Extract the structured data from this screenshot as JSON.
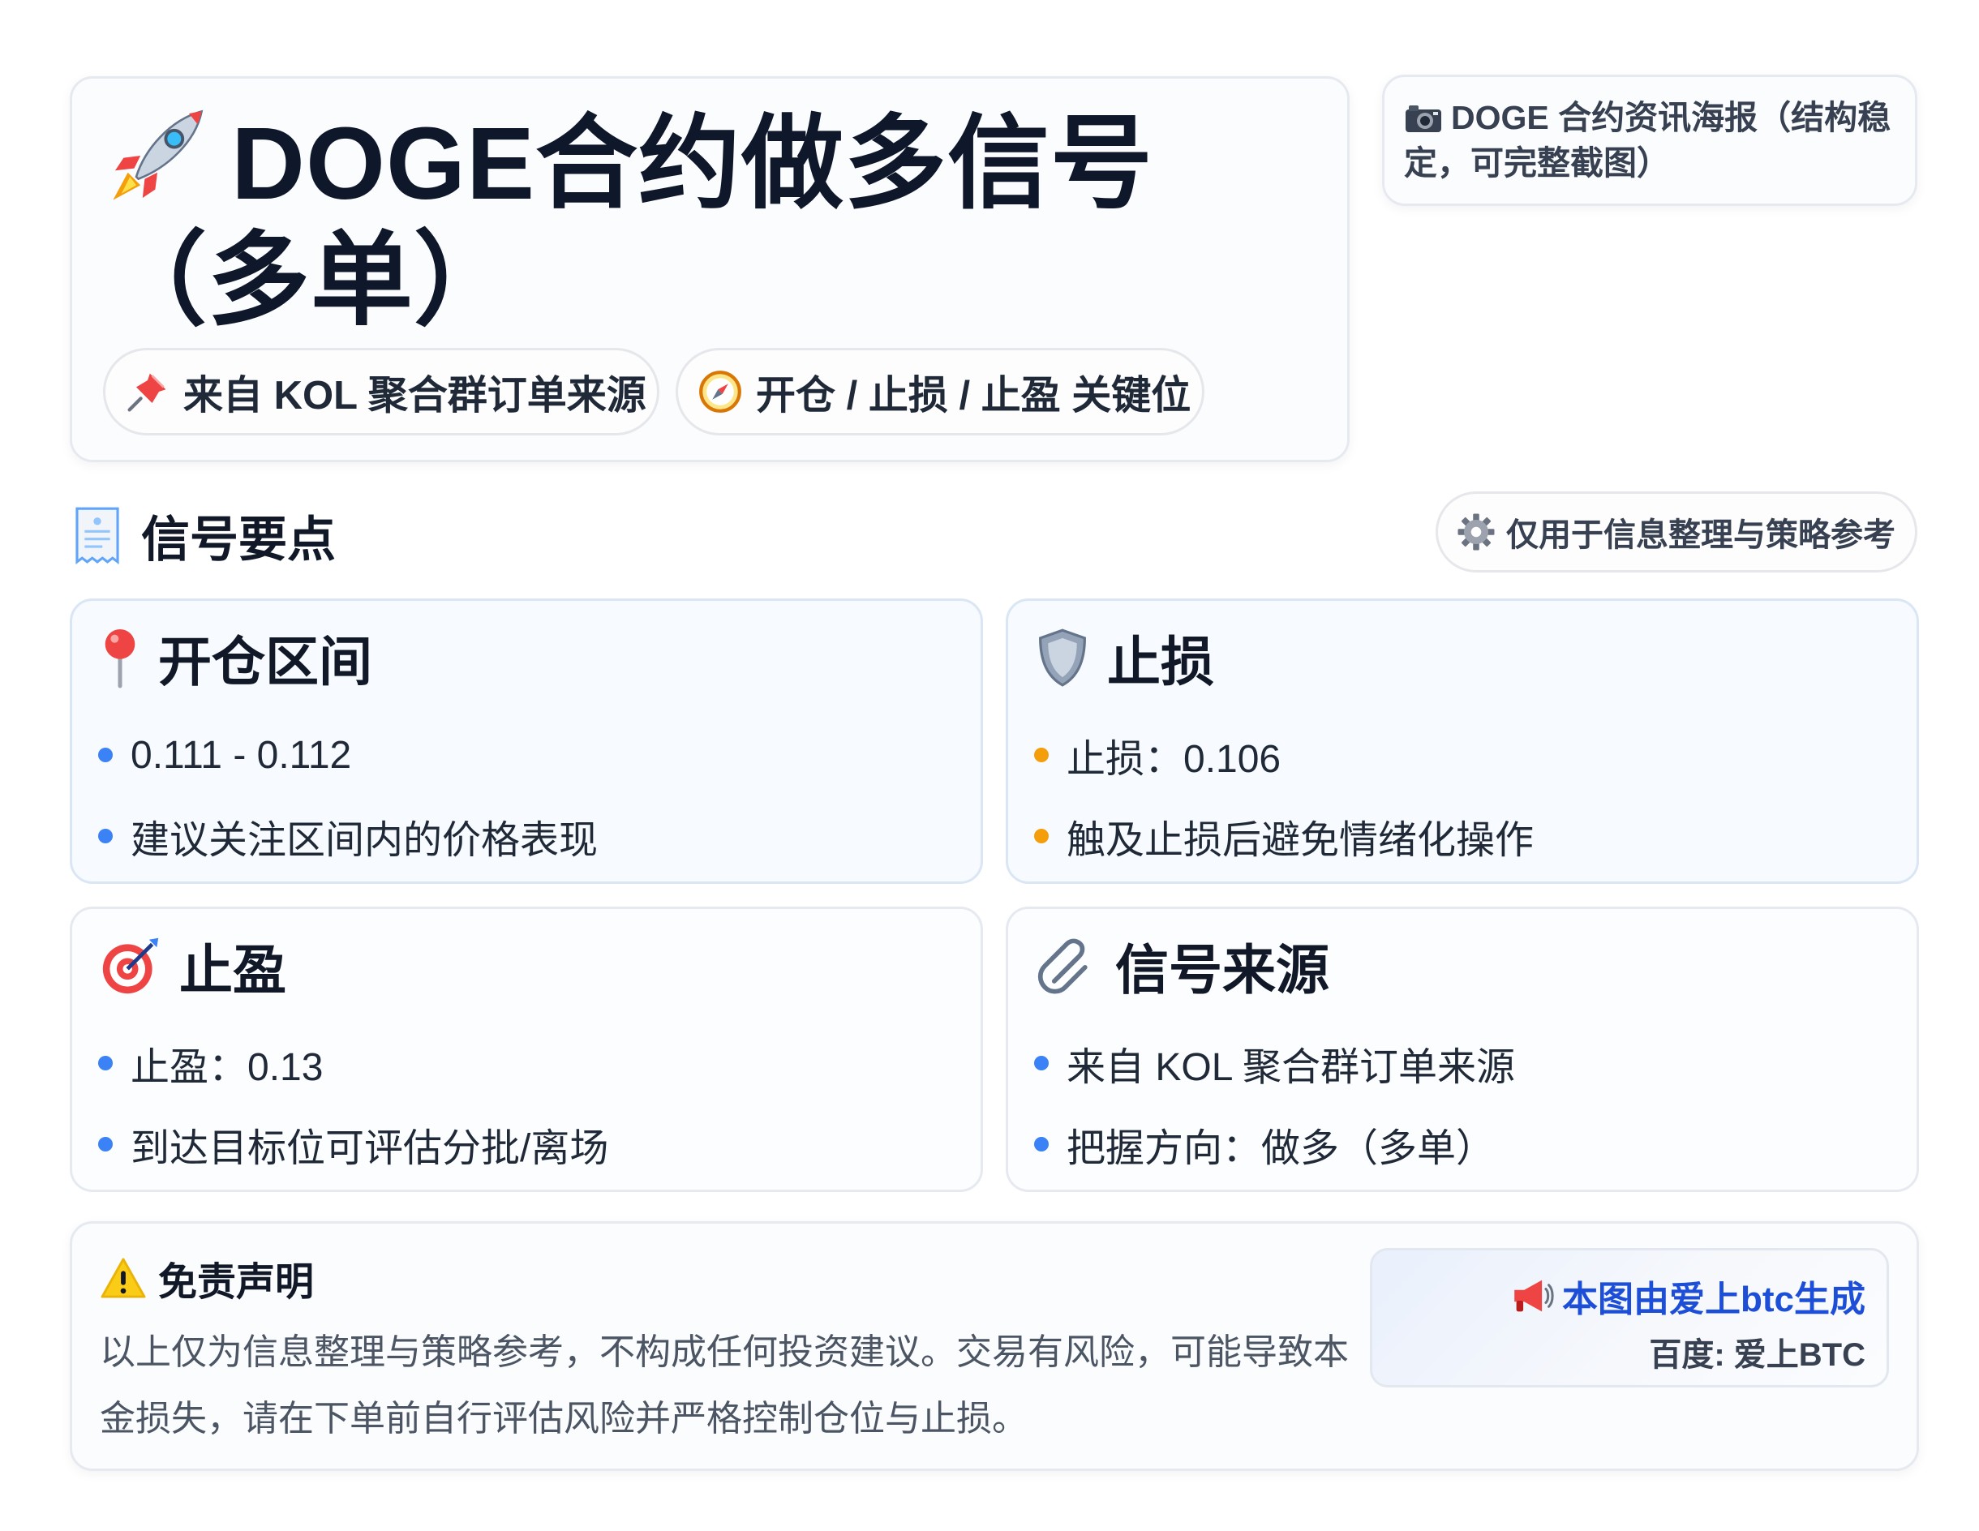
{
  "header": {
    "title": "DOGE合约做多信号（多单）",
    "title_icon": "rocket-icon",
    "chips": [
      {
        "icon": "pushpin-icon",
        "label": "来自 KOL 聚合群订单来源"
      },
      {
        "icon": "compass-icon",
        "label": "开仓 / 止损 / 止盈 关键位"
      }
    ]
  },
  "poster_note": {
    "icon": "camera-icon",
    "text": "DOGE 合约资讯海报（结构稳定，可完整截图）"
  },
  "section": {
    "icon": "receipt-icon",
    "title": "信号要点",
    "reference_icon": "gear-icon",
    "reference_label": "仅用于信息整理与策略参考"
  },
  "cards": {
    "entry": {
      "icon": "location-pin-icon",
      "title": "开仓区间",
      "items": [
        "0.111 - 0.112",
        "建议关注区间内的价格表现"
      ],
      "bullet_color": "#3b82f6"
    },
    "stop_loss": {
      "icon": "shield-icon",
      "title": "止损",
      "items": [
        "止损：0.106",
        "触及止损后避免情绪化操作"
      ],
      "bullet_color": "#f59e0b"
    },
    "take_profit": {
      "icon": "target-icon",
      "title": "止盈",
      "items": [
        "止盈：0.13",
        "到达目标位可评估分批/离场"
      ],
      "bullet_color": "#3b82f6"
    },
    "source": {
      "icon": "paperclip-icon",
      "title": "信号来源",
      "items": [
        "来自 KOL 聚合群订单来源",
        "把握方向：做多（多单）"
      ],
      "bullet_color": "#3b82f6"
    }
  },
  "disclaimer": {
    "icon": "warning-icon",
    "title": "免责声明",
    "text": "以上仅为信息整理与策略参考，不构成任何投资建议。交易有风险，可能导致本金损失，请在下单前自行评估风险并严格控制仓位与止损。"
  },
  "credit": {
    "icon": "megaphone-icon",
    "line1": "本图由爱上btc生成",
    "line2": "百度: 爱上BTC"
  },
  "colors": {
    "accent_blue": "#1d4ed8",
    "bullet_blue": "#3b82f6",
    "bullet_orange": "#f59e0b",
    "title": "#0f172a"
  }
}
